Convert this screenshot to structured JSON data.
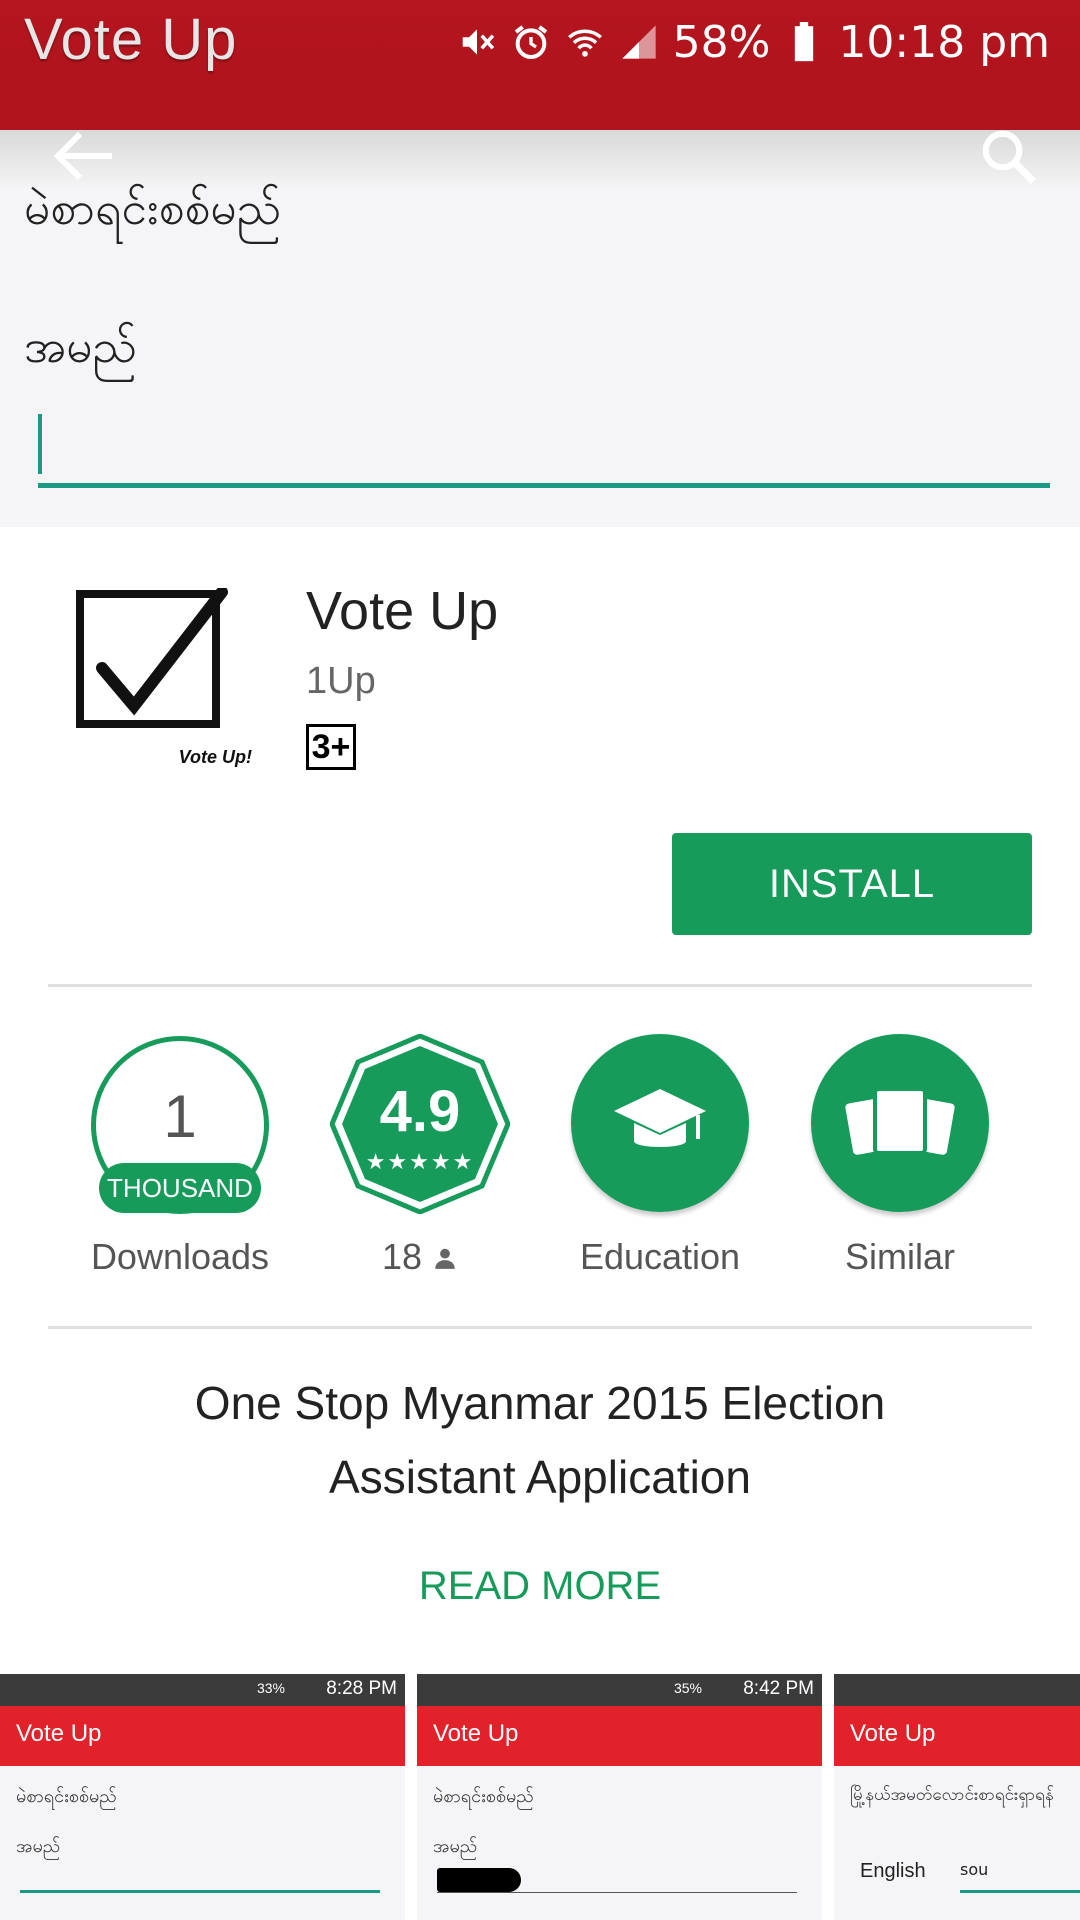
{
  "status_bar": {
    "app_title": "Vote Up",
    "battery": "58%",
    "time": "10:18 pm",
    "icons": [
      "mute-icon",
      "alarm-icon",
      "wifi-icon",
      "signal-icon",
      "battery-icon"
    ]
  },
  "form": {
    "header_label": "မဲစာရင်းစစ်မည်",
    "name_label": "အမည်",
    "name_value": ""
  },
  "app": {
    "icon_caption": "Vote Up!",
    "title": "Vote Up",
    "developer": "1Up",
    "content_rating": "3+",
    "install_label": "INSTALL"
  },
  "stats": {
    "downloads_number": "1",
    "downloads_unit": "THOUSAND",
    "downloads_label": "Downloads",
    "rating": "4.9",
    "rating_stars": "★★★★★",
    "rating_count": "18",
    "category_label": "Education",
    "similar_label": "Similar"
  },
  "description": {
    "line1": "One Stop Myanmar 2015 Election",
    "line2": "Assistant Application",
    "read_more": "READ MORE"
  },
  "screenshots": [
    {
      "time": "8:28 PM",
      "battery": "33%",
      "title": "Vote Up",
      "line1": "မဲစာရင်းစစ်မည်",
      "line2": "အမည်"
    },
    {
      "time": "8:42 PM",
      "battery": "35%",
      "title": "Vote Up",
      "line1": "မဲစာရင်းစစ်မည်",
      "line2": "အမည်"
    },
    {
      "time": "",
      "battery": "",
      "title": "Vote Up",
      "line1": "မြို့နယ်အမတ်လောင်းစာရင်းရှာရန်",
      "lang": "English",
      "input": "sou"
    }
  ],
  "colors": {
    "status_red": "#b0141c",
    "accent_green": "#179b5b",
    "input_teal": "#1a9a82",
    "shot_red": "#e2222b"
  }
}
